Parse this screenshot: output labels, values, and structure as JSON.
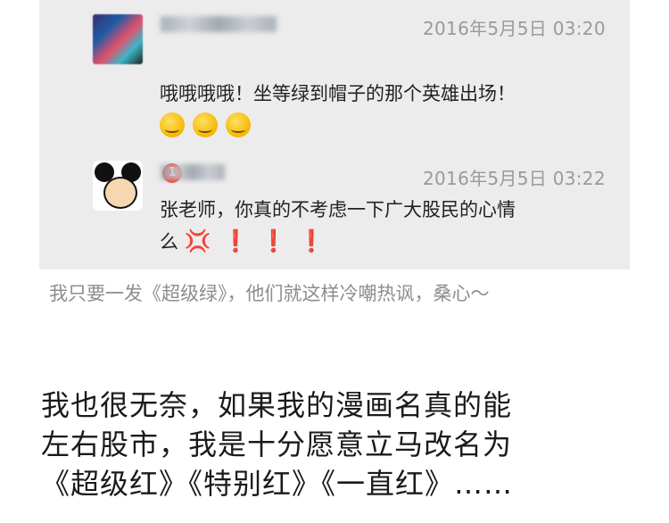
{
  "chat": {
    "messages": [
      {
        "timestamp": "2016年5月5日 03:20",
        "text": "哦哦哦哦！坐等绿到帽子的那个英雄出场！",
        "emoji": [
          "grimace-emoji",
          "grimace-emoji",
          "grimace-emoji"
        ]
      },
      {
        "timestamp": "2016年5月5日 03:22",
        "badge": "1",
        "text_line1": "张老师，你真的不考虑一下广大股民的心情",
        "text_line2": "么",
        "marks": [
          "❗",
          "❗",
          "❗"
        ]
      }
    ]
  },
  "caption": "我只要一发《超级绿》，他们就这样冷嘲热讽，桑心～",
  "body_text": {
    "line1": "我也很无奈，如果我的漫画名真的能",
    "line2": "左右股市，我是十分愿意立马改名为",
    "line3": "《超级红》《特别红》《一直红》……"
  }
}
